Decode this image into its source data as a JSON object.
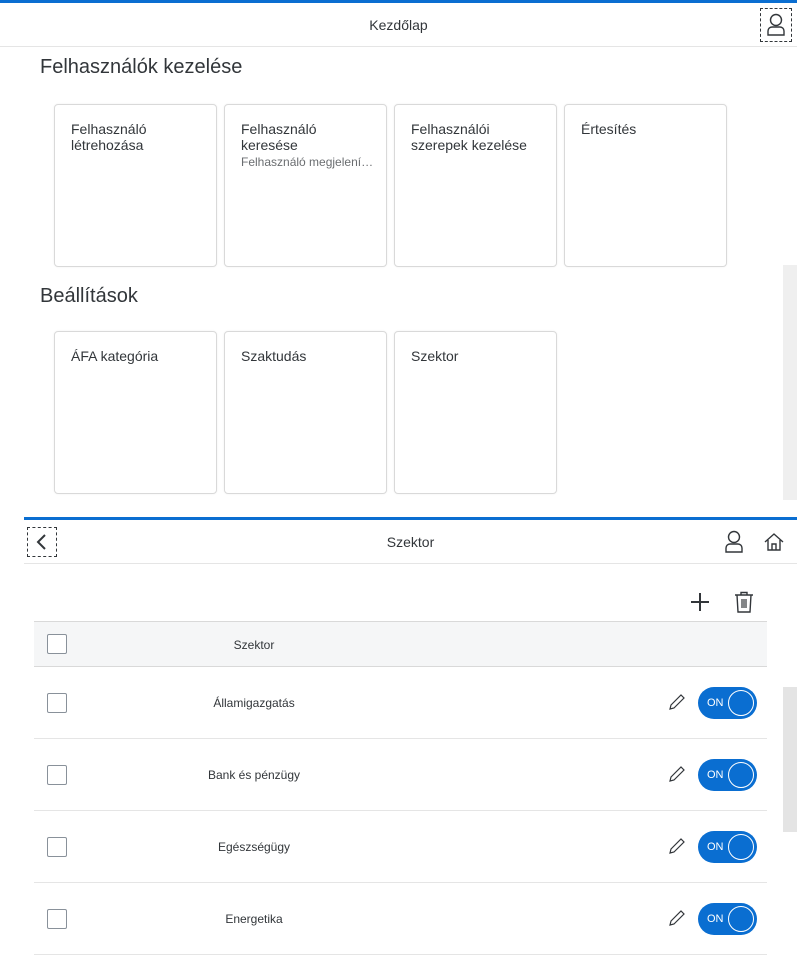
{
  "screen1": {
    "header": {
      "title": "Kezdőlap",
      "user_icon": "user-icon"
    },
    "sections": [
      {
        "title": "Felhasználók kezelése",
        "tiles": [
          {
            "title_line1": "Felhasználó",
            "title_line2": "létrehozása",
            "subtitle": ""
          },
          {
            "title_line1": "Felhasználó",
            "title_line2": "keresése",
            "subtitle": "Felhasználó megjelenítése"
          },
          {
            "title_line1": "Felhasználói",
            "title_line2": "szerepek kezelése",
            "subtitle": ""
          },
          {
            "title_line1": "Értesítés",
            "title_line2": "",
            "subtitle": ""
          }
        ]
      },
      {
        "title": "Beállítások",
        "tiles": [
          {
            "title_line1": "ÁFA kategória",
            "title_line2": "",
            "subtitle": ""
          },
          {
            "title_line1": "Szaktudás",
            "title_line2": "",
            "subtitle": ""
          },
          {
            "title_line1": "Szektor",
            "title_line2": "",
            "subtitle": ""
          }
        ]
      }
    ]
  },
  "screen2": {
    "header": {
      "title": "Szektor",
      "back_icon": "chevron-left-icon",
      "user_icon": "user-icon",
      "home_icon": "home-icon"
    },
    "toolbar": {
      "add_icon": "plus-icon",
      "delete_icon": "trash-icon"
    },
    "table": {
      "column_header": "Szektor",
      "rows": [
        {
          "name": "Államigazgatás",
          "switch_label": "ON",
          "active": true
        },
        {
          "name": "Bank és pénzügy",
          "switch_label": "ON",
          "active": true
        },
        {
          "name": "Egészségügy",
          "switch_label": "ON",
          "active": true
        },
        {
          "name": "Energetika",
          "switch_label": "ON",
          "active": true
        }
      ]
    }
  },
  "colors": {
    "accent": "#0a6ed1",
    "text": "#32363a",
    "border": "#d9d9d9"
  }
}
